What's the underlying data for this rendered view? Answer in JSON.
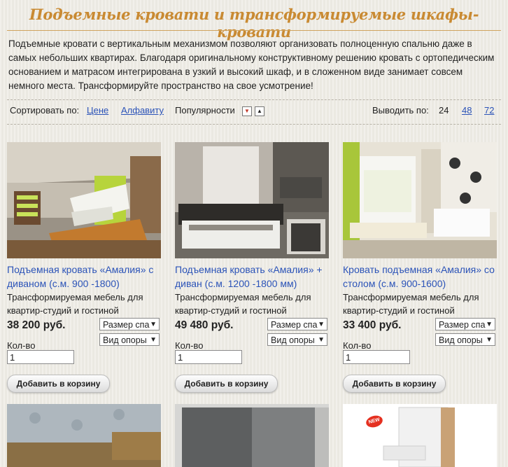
{
  "page": {
    "title": "Подъемные кровати и трансформируемые шкафы-кровати",
    "intro": "Подъемные кровати с вертикальным механизмом позволяют организовать полноценную спальню даже в самых небольших квартирах. Благодаря оригинальному конструктивному решению кровать с ортопедическим основанием и матрасом интегрирована в узкий и высокий шкаф, и в сложенном виде занимает совсем немного места. Трансформируйте пространство на свое усмотрение!"
  },
  "sort": {
    "label": "Сортировать по:",
    "by_price": "Цене",
    "by_alpha": "Алфавиту",
    "by_pop": "Популярности",
    "desc_icon": "▼",
    "asc_icon": "▲"
  },
  "perpage": {
    "label": "Выводить по:",
    "current": "24",
    "opt48": "48",
    "opt72": "72"
  },
  "products": [
    {
      "name": "Подъемная кровать «Амалия» с диваном (с.м. 900 -1800)",
      "desc": "Трансформируемая мебель для квартир-студий и гостиной",
      "price": "38 200 руб.",
      "size_select": "Размер спа",
      "support_select": "Вид опоры",
      "qty_label": "Кол-во",
      "qty": "1",
      "add_label": "Добавить в корзину"
    },
    {
      "name": "Подъемная кровать «Амалия» + диван (с.м. 1200 -1800 мм)",
      "desc": "Трансформируемая мебель для квартир-студий и гостиной",
      "price": "49 480 руб.",
      "size_select": "Размер спа",
      "support_select": "Вид опоры",
      "qty_label": "Кол-во",
      "qty": "1",
      "add_label": "Добавить в корзину"
    },
    {
      "name": "Кровать подъемная «Амалия» со столом (с.м. 900-1600)",
      "desc": "Трансформируемая мебель для квартир-студий и гостиной",
      "price": "33 400 руб.",
      "size_select": "Размер спа",
      "support_select": "Вид опоры",
      "qty_label": "Кол-во",
      "qty": "1",
      "add_label": "Добавить в корзину"
    }
  ],
  "badge": "NEW",
  "colors": {
    "title": "#c98a32",
    "link": "#2b53b8",
    "background": "#efede6",
    "accent_green": "#a8c63a"
  }
}
